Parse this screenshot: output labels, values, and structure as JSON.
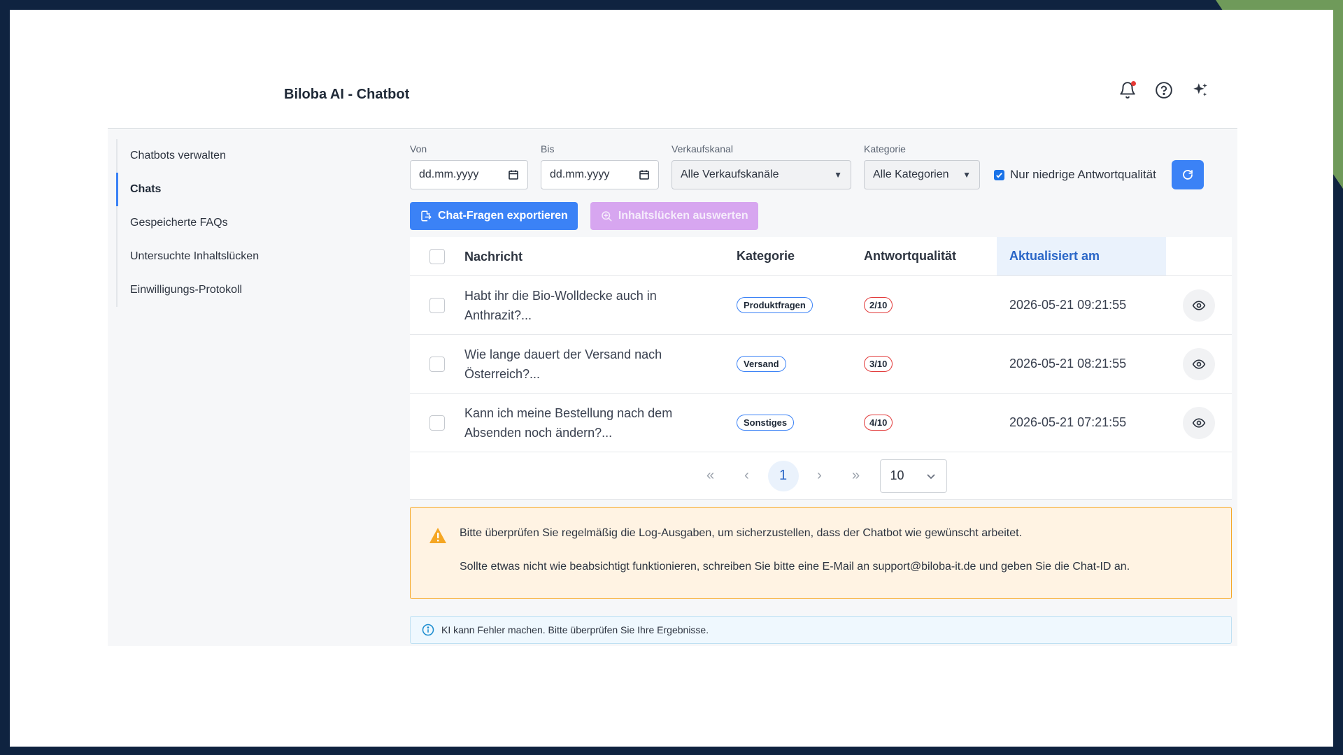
{
  "header": {
    "title": "Biloba AI - Chatbot",
    "icons": [
      "bell-icon",
      "help-icon",
      "sparkle-icon"
    ]
  },
  "sidebar": {
    "items": [
      {
        "label": "Chatbots verwalten"
      },
      {
        "label": "Chats"
      },
      {
        "label": "Gespeicherte FAQs"
      },
      {
        "label": "Untersuchte Inhaltslücken"
      },
      {
        "label": "Einwilligungs-Protokoll"
      }
    ],
    "active": "Chats"
  },
  "filters": {
    "from_label": "Von",
    "from_placeholder": "dd.mm.yyyy",
    "to_label": "Bis",
    "to_placeholder": "dd.mm.yyyy",
    "channel_label": "Verkaufskanal",
    "channel_value": "Alle Verkaufskanäle",
    "category_label": "Kategorie",
    "category_value": "Alle Kategorien",
    "low_quality_label": "Nur niedrige Antwortqualität",
    "low_quality_checked": true
  },
  "actions": {
    "export_label": "Chat-Fragen exportieren",
    "analyze_label": "Inhaltslücken auswerten"
  },
  "table": {
    "headers": {
      "message": "Nachricht",
      "category": "Kategorie",
      "quality": "Antwortqualität",
      "updated": "Aktualisiert am"
    },
    "rows": [
      {
        "message_line1": "Habt ihr die Bio-Wolldecke auch in",
        "message_line2": "Anthrazit?...",
        "category": "Produktfragen",
        "quality": "2/10",
        "updated": "2026-05-21 09:21:55"
      },
      {
        "message_line1": "Wie lange dauert der Versand nach",
        "message_line2": "Österreich?...",
        "category": "Versand",
        "quality": "3/10",
        "updated": "2026-05-21 08:21:55"
      },
      {
        "message_line1": "Kann ich meine Bestellung nach dem",
        "message_line2": "Absenden noch ändern?...",
        "category": "Sonstiges",
        "quality": "4/10",
        "updated": "2026-05-21 07:21:55"
      }
    ]
  },
  "pagination": {
    "current_page": "1",
    "page_size": "10"
  },
  "warning": {
    "line1": "Bitte überprüfen Sie regelmäßig die Log-Ausgaben, um sicherzustellen, dass der Chatbot wie gewünscht arbeitet.",
    "line2": "Sollte etwas nicht wie beabsichtigt funktionieren, schreiben Sie bitte eine E-Mail an support@biloba-it.de und geben Sie die Chat-ID an."
  },
  "info": {
    "text": "KI kann Fehler machen. Bitte überprüfen Sie Ihre Ergebnisse."
  },
  "colors": {
    "primary": "#3b82f6",
    "warning_border": "#f5a623",
    "quality_border": "#e23b3b",
    "background_frame": "#0f2340"
  }
}
